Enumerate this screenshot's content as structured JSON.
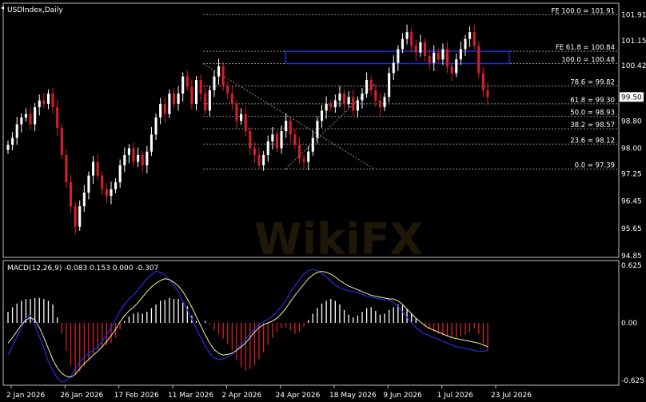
{
  "chart_data": [
    {
      "type": "candlestick",
      "title": "USDIndex,Daily",
      "colors": {
        "up": "#ffffff",
        "down": "#d81e2c",
        "grid": "#808080",
        "box": "#1e2bd6",
        "background": "#000000"
      },
      "ylim": [
        94.85,
        102.2
      ],
      "y_ticks": [
        "101.91",
        "101.15",
        "100.42",
        "99.50",
        "98.80",
        "98.00",
        "97.25",
        "96.45",
        "95.65",
        "94.85"
      ],
      "last_price": "99.50",
      "x_ticks": [
        "2 Jan 2026",
        "26 Jan 2026",
        "17 Feb 2026",
        "11 Mar 2026",
        "2 Apr 2026",
        "24 Apr 2026",
        "18 May 2026",
        "9 Jun 2026",
        "1 Jul 2026",
        "23 Jul 2026"
      ],
      "fib_levels": [
        {
          "label": "FE 100.0 = 101.91",
          "value": 101.91
        },
        {
          "label": "FE 61.8 = 100.84",
          "value": 100.84
        },
        {
          "label": "100.0 = 100.48",
          "value": 100.48
        },
        {
          "label": "78.6 = 99.82",
          "value": 99.82
        },
        {
          "label": "61.8 = 99.30",
          "value": 99.3
        },
        {
          "label": "50.0 = 98.93",
          "value": 98.93
        },
        {
          "label": "38.2 = 98.57",
          "value": 98.57
        },
        {
          "label": "23.6 = 98.12",
          "value": 98.12
        },
        {
          "label": "0.0 = 97.39",
          "value": 97.39
        }
      ],
      "resistance_zone": [
        100.48,
        100.84
      ],
      "closes": [
        98.1,
        98.3,
        98.7,
        98.9,
        99.0,
        98.7,
        99.2,
        99.4,
        99.3,
        99.6,
        99.2,
        98.6,
        97.8,
        97.0,
        96.3,
        95.7,
        96.3,
        96.7,
        97.2,
        97.6,
        97.2,
        96.8,
        96.6,
        96.8,
        97.0,
        97.5,
        97.8,
        98.0,
        97.6,
        97.8,
        97.5,
        97.9,
        98.4,
        98.9,
        99.3,
        99.0,
        99.6,
        99.3,
        99.6,
        100.1,
        99.8,
        99.3,
        100.0,
        99.6,
        99.1,
        99.7,
        100.1,
        100.4,
        99.8,
        99.6,
        99.3,
        98.8,
        99.0,
        98.5,
        98.0,
        97.8,
        97.5,
        97.8,
        98.2,
        98.4,
        98.0,
        98.5,
        98.8,
        98.4,
        98.1,
        97.7,
        97.6,
        97.9,
        98.3,
        98.8,
        99.1,
        99.3,
        99.2,
        99.4,
        99.6,
        99.3,
        99.5,
        99.1,
        99.4,
        99.6,
        100.0,
        99.7,
        99.4,
        99.2,
        99.5,
        100.2,
        100.5,
        100.9,
        101.2,
        101.4,
        101.0,
        100.8,
        101.1,
        100.7,
        100.5,
        100.8,
        100.6,
        100.9,
        100.4,
        100.2,
        100.6,
        100.9,
        101.2,
        101.4,
        101.0,
        100.2,
        99.7,
        99.5
      ]
    },
    {
      "type": "macd",
      "title": "MACD(12,26,9) -0.083 0.153 0.000 -0.307",
      "ylim": [
        -0.66,
        0.66
      ],
      "y_ticks": [
        "0.625",
        "0.00",
        "-0.625"
      ],
      "histogram": [
        0.12,
        0.17,
        0.21,
        0.24,
        0.26,
        0.26,
        0.27,
        0.27,
        0.26,
        0.24,
        0.2,
        0.06,
        -0.12,
        -0.3,
        -0.46,
        -0.56,
        -0.53,
        -0.47,
        -0.4,
        -0.33,
        -0.29,
        -0.26,
        -0.25,
        -0.22,
        -0.16,
        -0.07,
        0.02,
        0.07,
        0.1,
        0.11,
        0.1,
        0.12,
        0.16,
        0.2,
        0.24,
        0.25,
        0.27,
        0.26,
        0.26,
        0.22,
        0.18,
        0.08,
        0.02,
        0.0,
        0.02,
        -0.02,
        -0.08,
        -0.12,
        -0.17,
        -0.23,
        -0.3,
        -0.41,
        -0.48,
        -0.52,
        -0.5,
        -0.46,
        -0.4,
        -0.32,
        -0.24,
        -0.16,
        -0.1,
        -0.06,
        -0.05,
        -0.08,
        -0.12,
        -0.1,
        -0.04,
        0.03,
        0.1,
        0.16,
        0.21,
        0.24,
        0.26,
        0.24,
        0.2,
        0.14,
        0.09,
        0.06,
        0.08,
        0.12,
        0.16,
        0.17,
        0.13,
        0.09,
        0.1,
        0.14,
        0.17,
        0.2,
        0.19,
        0.15,
        0.1,
        0.05,
        0.0,
        -0.04,
        -0.07,
        -0.1,
        -0.12,
        -0.14,
        -0.15,
        -0.16,
        -0.16,
        -0.15,
        -0.13,
        -0.1,
        -0.06,
        -0.12,
        -0.22,
        -0.3
      ],
      "signal": [
        -0.22,
        -0.16,
        -0.09,
        -0.02,
        0.03,
        0.06,
        0.03,
        -0.05,
        -0.16,
        -0.28,
        -0.4,
        -0.49,
        -0.55,
        -0.58,
        -0.59,
        -0.56,
        -0.5,
        -0.44,
        -0.4,
        -0.35,
        -0.31,
        -0.26,
        -0.2,
        -0.14,
        -0.07,
        0.01,
        0.08,
        0.13,
        0.17,
        0.22,
        0.28,
        0.34,
        0.39,
        0.43,
        0.46,
        0.48,
        0.47,
        0.44,
        0.4,
        0.34,
        0.26,
        0.17,
        0.07,
        -0.03,
        -0.13,
        -0.22,
        -0.29,
        -0.33,
        -0.35,
        -0.34,
        -0.33,
        -0.3,
        -0.26,
        -0.22,
        -0.16,
        -0.1,
        -0.05,
        -0.02,
        0.0,
        0.02,
        0.05,
        0.1,
        0.16,
        0.23,
        0.3,
        0.36,
        0.42,
        0.48,
        0.52,
        0.55,
        0.56,
        0.55,
        0.53,
        0.5,
        0.46,
        0.43,
        0.4,
        0.38,
        0.36,
        0.34,
        0.32,
        0.3,
        0.29,
        0.28,
        0.27,
        0.26,
        0.26,
        0.24,
        0.2,
        0.15,
        0.1,
        0.05,
        0.01,
        -0.03,
        -0.06,
        -0.08,
        -0.1,
        -0.12,
        -0.14,
        -0.16,
        -0.17,
        -0.18,
        -0.19,
        -0.2,
        -0.21,
        -0.22,
        -0.24,
        -0.26
      ],
      "macd": [
        -0.35,
        -0.25,
        -0.15,
        -0.05,
        0.05,
        0.08,
        -0.02,
        -0.15,
        -0.28,
        -0.42,
        -0.52,
        -0.6,
        -0.64,
        -0.63,
        -0.58,
        -0.5,
        -0.42,
        -0.38,
        -0.33,
        -0.3,
        -0.26,
        -0.2,
        -0.13,
        -0.05,
        0.04,
        0.13,
        0.2,
        0.26,
        0.3,
        0.36,
        0.42,
        0.48,
        0.52,
        0.56,
        0.55,
        0.52,
        0.47,
        0.41,
        0.33,
        0.24,
        0.14,
        0.04,
        -0.06,
        -0.16,
        -0.25,
        -0.33,
        -0.38,
        -0.4,
        -0.39,
        -0.37,
        -0.34,
        -0.29,
        -0.24,
        -0.18,
        -0.12,
        -0.06,
        -0.02,
        0.01,
        0.04,
        0.07,
        0.12,
        0.18,
        0.25,
        0.33,
        0.4,
        0.47,
        0.53,
        0.57,
        0.58,
        0.57,
        0.54,
        0.5,
        0.45,
        0.41,
        0.38,
        0.36,
        0.35,
        0.34,
        0.33,
        0.31,
        0.29,
        0.28,
        0.27,
        0.26,
        0.25,
        0.25,
        0.22,
        0.18,
        0.12,
        0.06,
        0.0,
        -0.05,
        -0.09,
        -0.12,
        -0.14,
        -0.16,
        -0.18,
        -0.2,
        -0.22,
        -0.24,
        -0.26,
        -0.27,
        -0.28,
        -0.29,
        -0.3,
        -0.31,
        -0.31,
        -0.3
      ]
    }
  ],
  "watermark": "WikiFX"
}
